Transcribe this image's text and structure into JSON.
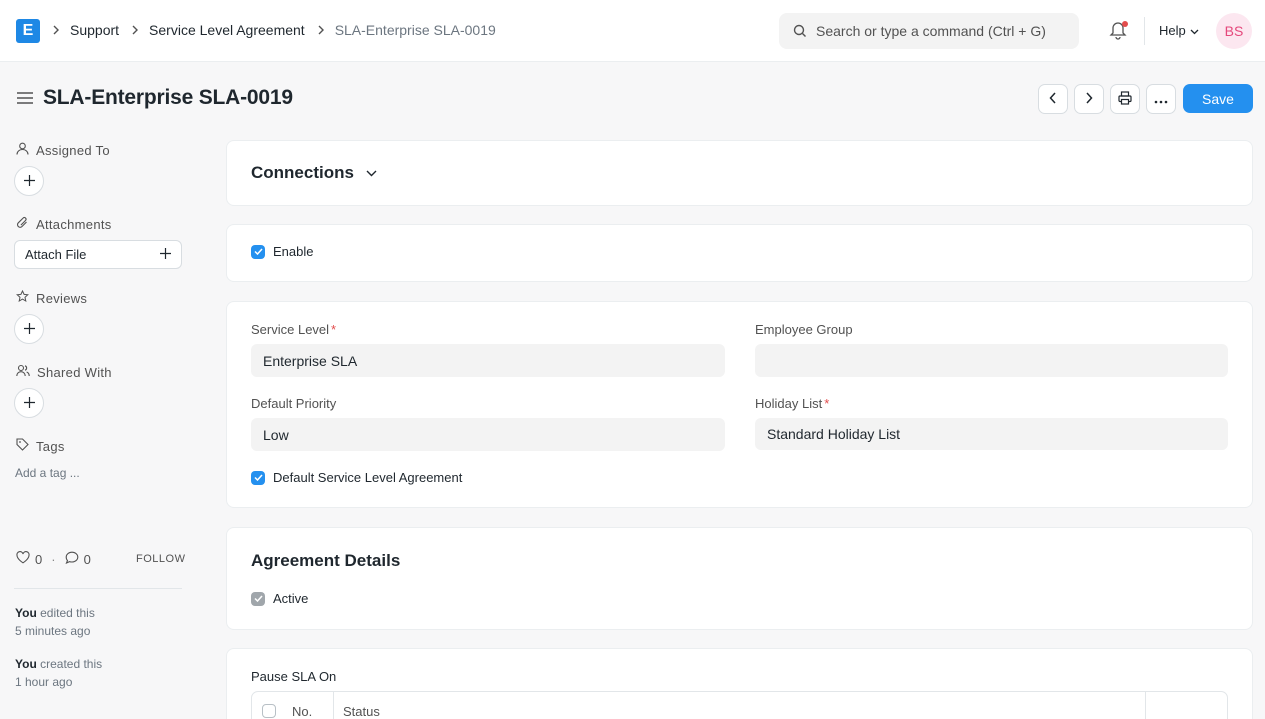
{
  "navbar": {
    "logo_letter": "E",
    "breadcrumbs": [
      "Support",
      "Service Level Agreement",
      "SLA-Enterprise SLA-0019"
    ],
    "search_placeholder": "Search or type a command (Ctrl + G)",
    "help_label": "Help",
    "avatar_initials": "BS"
  },
  "page": {
    "title": "SLA-Enterprise SLA-0019",
    "save_label": "Save"
  },
  "sidebar": {
    "assigned_to": "Assigned To",
    "attachments": "Attachments",
    "attach_file": "Attach File",
    "reviews": "Reviews",
    "shared_with": "Shared With",
    "tags": "Tags",
    "add_tag": "Add a tag ...",
    "likes": "0",
    "comments": "0",
    "follow": "FOLLOW",
    "activity": [
      {
        "who": "You",
        "action": " edited this",
        "when": "5 minutes ago"
      },
      {
        "who": "You",
        "action": " created this",
        "when": "1 hour ago"
      }
    ]
  },
  "connections": {
    "title": "Connections"
  },
  "enable": {
    "label": "Enable",
    "checked": true
  },
  "form": {
    "service_level_label": "Service Level",
    "service_level_value": "Enterprise SLA",
    "employee_group_label": "Employee Group",
    "employee_group_value": "",
    "default_priority_label": "Default Priority",
    "default_priority_value": "Low",
    "holiday_list_label": "Holiday List",
    "holiday_list_value": "Standard Holiday List",
    "default_sla_label": "Default Service Level Agreement",
    "required_mark": "*"
  },
  "agreement": {
    "title": "Agreement Details",
    "active_label": "Active"
  },
  "pause": {
    "label": "Pause SLA On",
    "columns": [
      "No.",
      "Status"
    ]
  },
  "colors": {
    "primary": "#2490ef",
    "logo": "#1e88e5",
    "required": "#e24c4c"
  }
}
